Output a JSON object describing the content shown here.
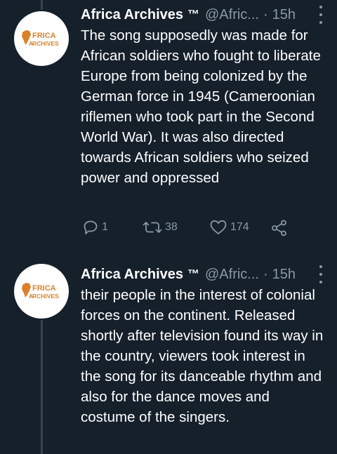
{
  "tweets": [
    {
      "author_name": "Africa Archives",
      "author_badge": "™",
      "handle": "@Afric...",
      "separator": "·",
      "time": "15h",
      "avatar_logo": {
        "line1": "AFRICA",
        "line2": "ARCHIVES"
      },
      "text": "The song supposedly was made for African soldiers who fought to liberate Europe from being colonized by the German force in 1945 (Cameroonian riflemen who took part in the Second World War). It was also directed towards African soldiers who seized power and oppressed",
      "replies": "1",
      "retweets": "38",
      "likes": "174"
    },
    {
      "author_name": "Africa Archives",
      "author_badge": "™",
      "handle": "@Afric...",
      "separator": "·",
      "time": "15h",
      "avatar_logo": {
        "line1": "AFRICA",
        "line2": "ARCHIVES"
      },
      "text": "their people in the interest of colonial forces on the continent. Released shortly after television found its way in the country, viewers took interest in the song for its danceable rhythm and also for the dance moves and costume of the singers."
    }
  ],
  "icons": [
    "reply-icon",
    "retweet-icon",
    "like-icon",
    "share-icon",
    "more-icon"
  ],
  "colors": {
    "background": "#15202b",
    "text": "#ffffff",
    "muted": "#8899a6",
    "logo_orange": "#d9822b"
  }
}
